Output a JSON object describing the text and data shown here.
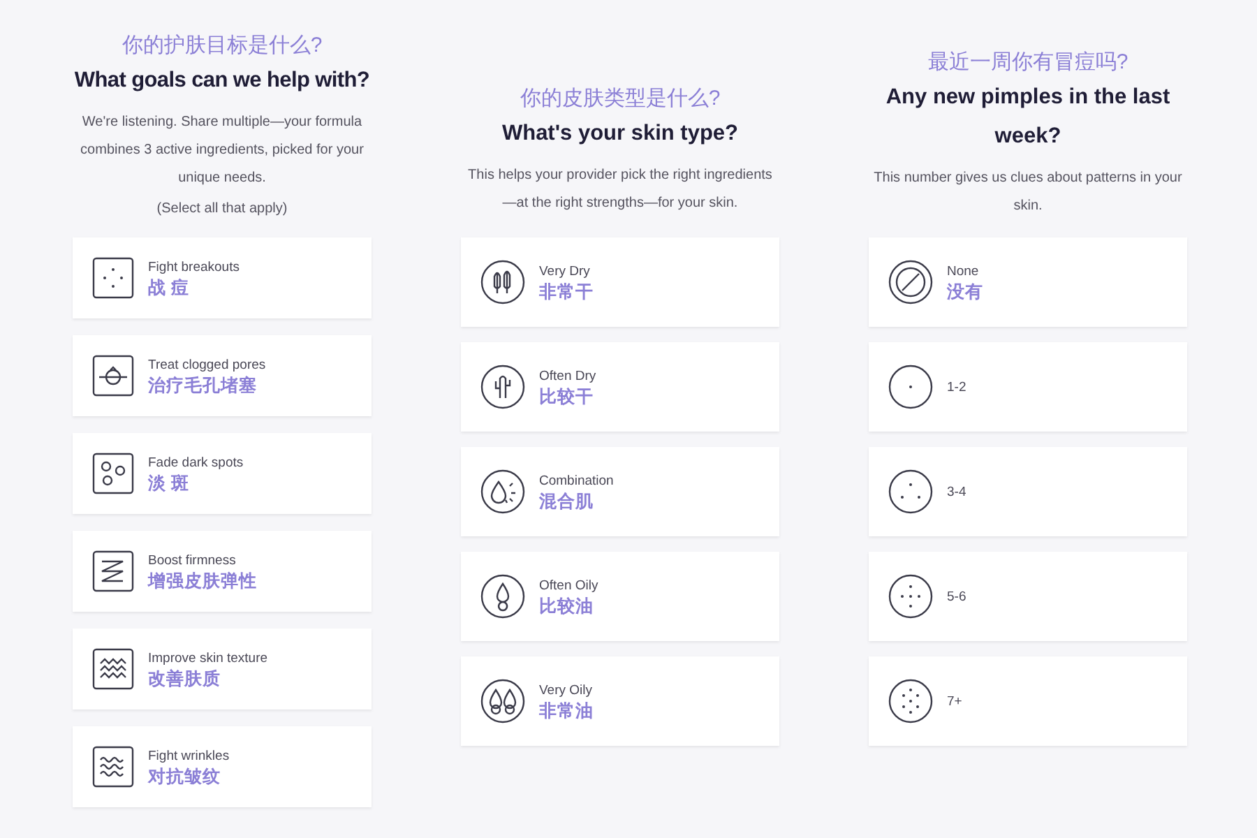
{
  "sections": [
    {
      "title_zh": "你的护肤目标是什么?",
      "title_en": "What goals can we help with?",
      "description": "We're listening. Share multiple—your formula combines 3 active ingredients, picked for your unique needs.",
      "note": "(Select all that apply)",
      "options": [
        {
          "kind": "dots-square",
          "label": "Fight breakouts",
          "label_zh": "战 痘"
        },
        {
          "kind": "pore-square",
          "label": "Treat clogged pores",
          "label_zh": "治疗毛孔堵塞"
        },
        {
          "kind": "spots-square",
          "label": "Fade dark spots",
          "label_zh": "淡 斑"
        },
        {
          "kind": "zigzag-square",
          "label": "Boost firmness",
          "label_zh": "增强皮肤弹性"
        },
        {
          "kind": "peaks-square",
          "label": "Improve skin texture",
          "label_zh": "改善肤质"
        },
        {
          "kind": "waves-square",
          "label": "Fight wrinkles",
          "label_zh": "对抗皱纹"
        }
      ]
    },
    {
      "title_zh": "你的皮肤类型是什么?",
      "title_en": "What's your skin type?",
      "description": "This helps your provider pick the right ingredients —at the right strengths—for your skin.",
      "options": [
        {
          "kind": "tree-circle",
          "label": "Very Dry",
          "label_zh": "非常干"
        },
        {
          "kind": "cactus-circle",
          "label": "Often Dry",
          "label_zh": "比较干"
        },
        {
          "kind": "combo-circle",
          "label": "Combination",
          "label_zh": "混合肌"
        },
        {
          "kind": "drop-circle",
          "label": "Often Oily",
          "label_zh": "比较油"
        },
        {
          "kind": "drops-circle",
          "label": "Very Oily",
          "label_zh": "非常油"
        }
      ]
    },
    {
      "title_zh": "最近一周你有冒痘吗?",
      "title_en": "Any new pimples in the last week?",
      "description": "This number gives us clues about patterns in your skin.",
      "options": [
        {
          "kind": "none-circle",
          "label": "None",
          "label_zh": "没有"
        },
        {
          "kind": "dot1-circle",
          "label": "1-2"
        },
        {
          "kind": "dot3-circle",
          "label": "3-4"
        },
        {
          "kind": "dot5-circle",
          "label": "5-6"
        },
        {
          "kind": "dot7-circle",
          "label": "7+"
        }
      ]
    }
  ]
}
